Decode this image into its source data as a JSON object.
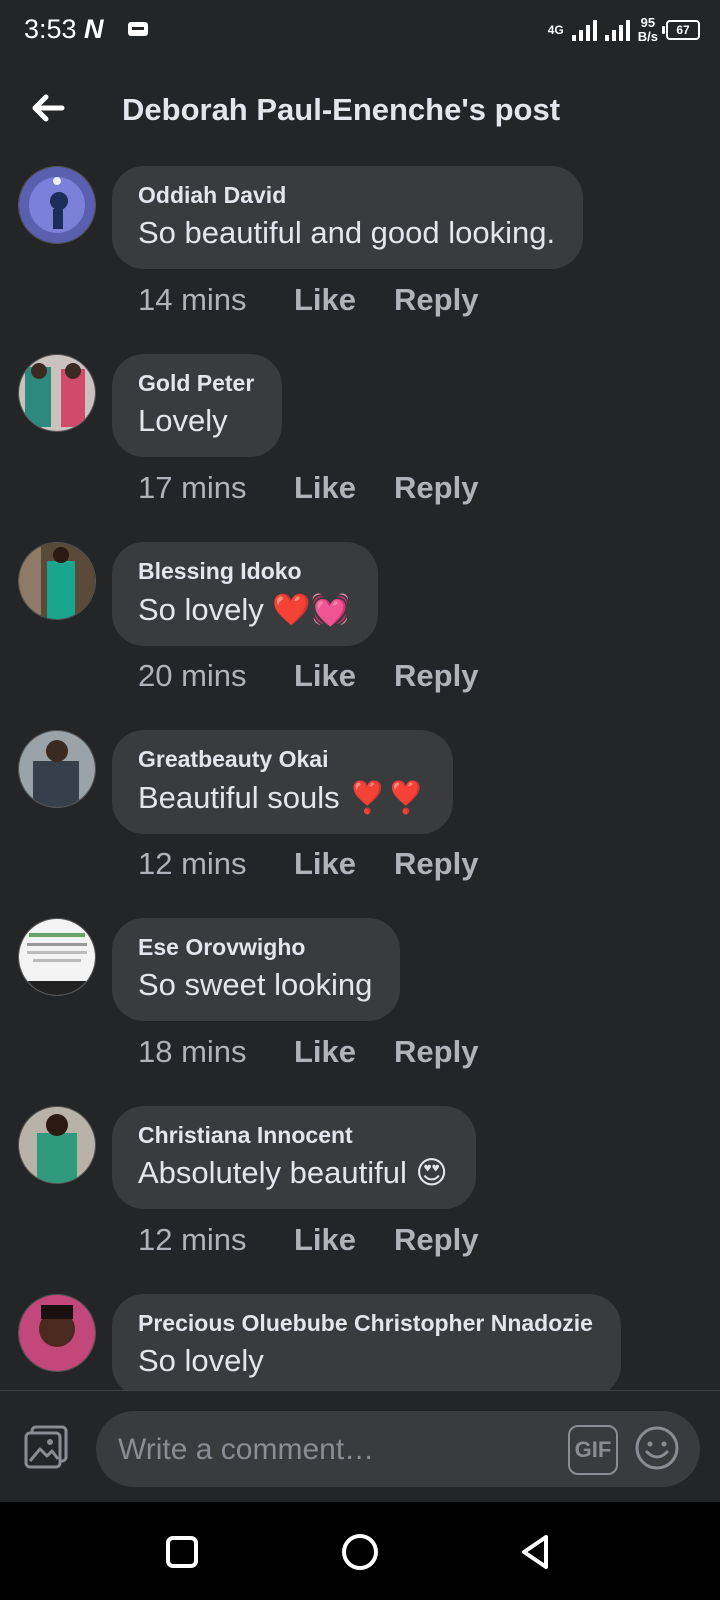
{
  "status_bar": {
    "time": "3:53",
    "carrier_logo": "N",
    "network": "4G",
    "speed_value": "95",
    "speed_unit": "B/s",
    "battery": "67"
  },
  "header": {
    "back_icon": "arrow-left-icon",
    "title": "Deborah Paul-Enenche's post"
  },
  "actions": {
    "like": "Like",
    "reply": "Reply"
  },
  "comments": [
    {
      "name": "Oddiah David",
      "text": "So beautiful and good looking.",
      "time": "14 mins"
    },
    {
      "name": "Gold Peter",
      "text": "Lovely",
      "time": "17 mins"
    },
    {
      "name": "Blessing Idoko",
      "text": "So lovely ❤️💓",
      "time": "20 mins"
    },
    {
      "name": "Greatbeauty Okai",
      "text": "Beautiful souls ❣️❣️",
      "time": "12 mins"
    },
    {
      "name": "Ese Orovwigho",
      "text": "So sweet looking",
      "time": "18 mins"
    },
    {
      "name": "Christiana Innocent",
      "text": "Absolutely beautiful 😍",
      "time": "12 mins"
    },
    {
      "name": "Precious Oluebube Christopher Nnadozie",
      "text": "So lovely",
      "time": ""
    }
  ],
  "composer": {
    "placeholder": "Write a comment…",
    "gif_label": "GIF",
    "photo_icon": "photo-icon",
    "emoji_icon": "smiley-icon"
  },
  "navbar": {
    "recent_icon": "square-icon",
    "home_icon": "circle-icon",
    "back_icon": "triangle-back-icon"
  },
  "colors": {
    "background": "#242527",
    "bubble": "#3a3b3c",
    "text": "#e4e6eb",
    "secondary_text": "#b0b3b8"
  }
}
